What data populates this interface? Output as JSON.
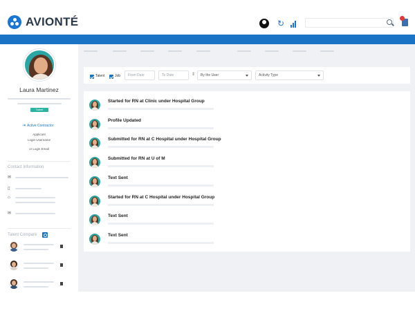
{
  "app": {
    "brand": "AVIONTÉ",
    "accent_color": "#1a73c4"
  },
  "header": {
    "icons": [
      "user-icon",
      "refresh-icon",
      "stats-icon",
      "search-icon",
      "notification-icon"
    ],
    "search": {
      "placeholder": ""
    }
  },
  "profile": {
    "name": "Laura Martinez",
    "badge": "Talent",
    "status": "Active Contractor",
    "lines": [
      "Applicant",
      "Login Username",
      "or Login Email"
    ]
  },
  "sidebar": {
    "contact_title": "Contact Information",
    "contact_icons": [
      "mail-icon",
      "phone-icon",
      "home-icon",
      "message-icon"
    ],
    "compare_title": "Talent Compare"
  },
  "filters": {
    "talent_label": "Talent",
    "job_label": "Job",
    "from_date_placeholder": "From Date",
    "to_date_placeholder": "To Date",
    "user_select": "By the User",
    "activity_select": "Activity Type"
  },
  "activities": [
    {
      "title": "Started for RN at Clinic under Hospital Group"
    },
    {
      "title": "Profile Updated"
    },
    {
      "title": "Submitted for RN at C Hospital under Hospital Group"
    },
    {
      "title": "Submitted for RN at U of M"
    },
    {
      "title": "Text Sent"
    },
    {
      "title": "Started for RN at C Hospital under Hospital Group"
    },
    {
      "title": "Text Sent"
    },
    {
      "title": "Text Sent"
    }
  ]
}
